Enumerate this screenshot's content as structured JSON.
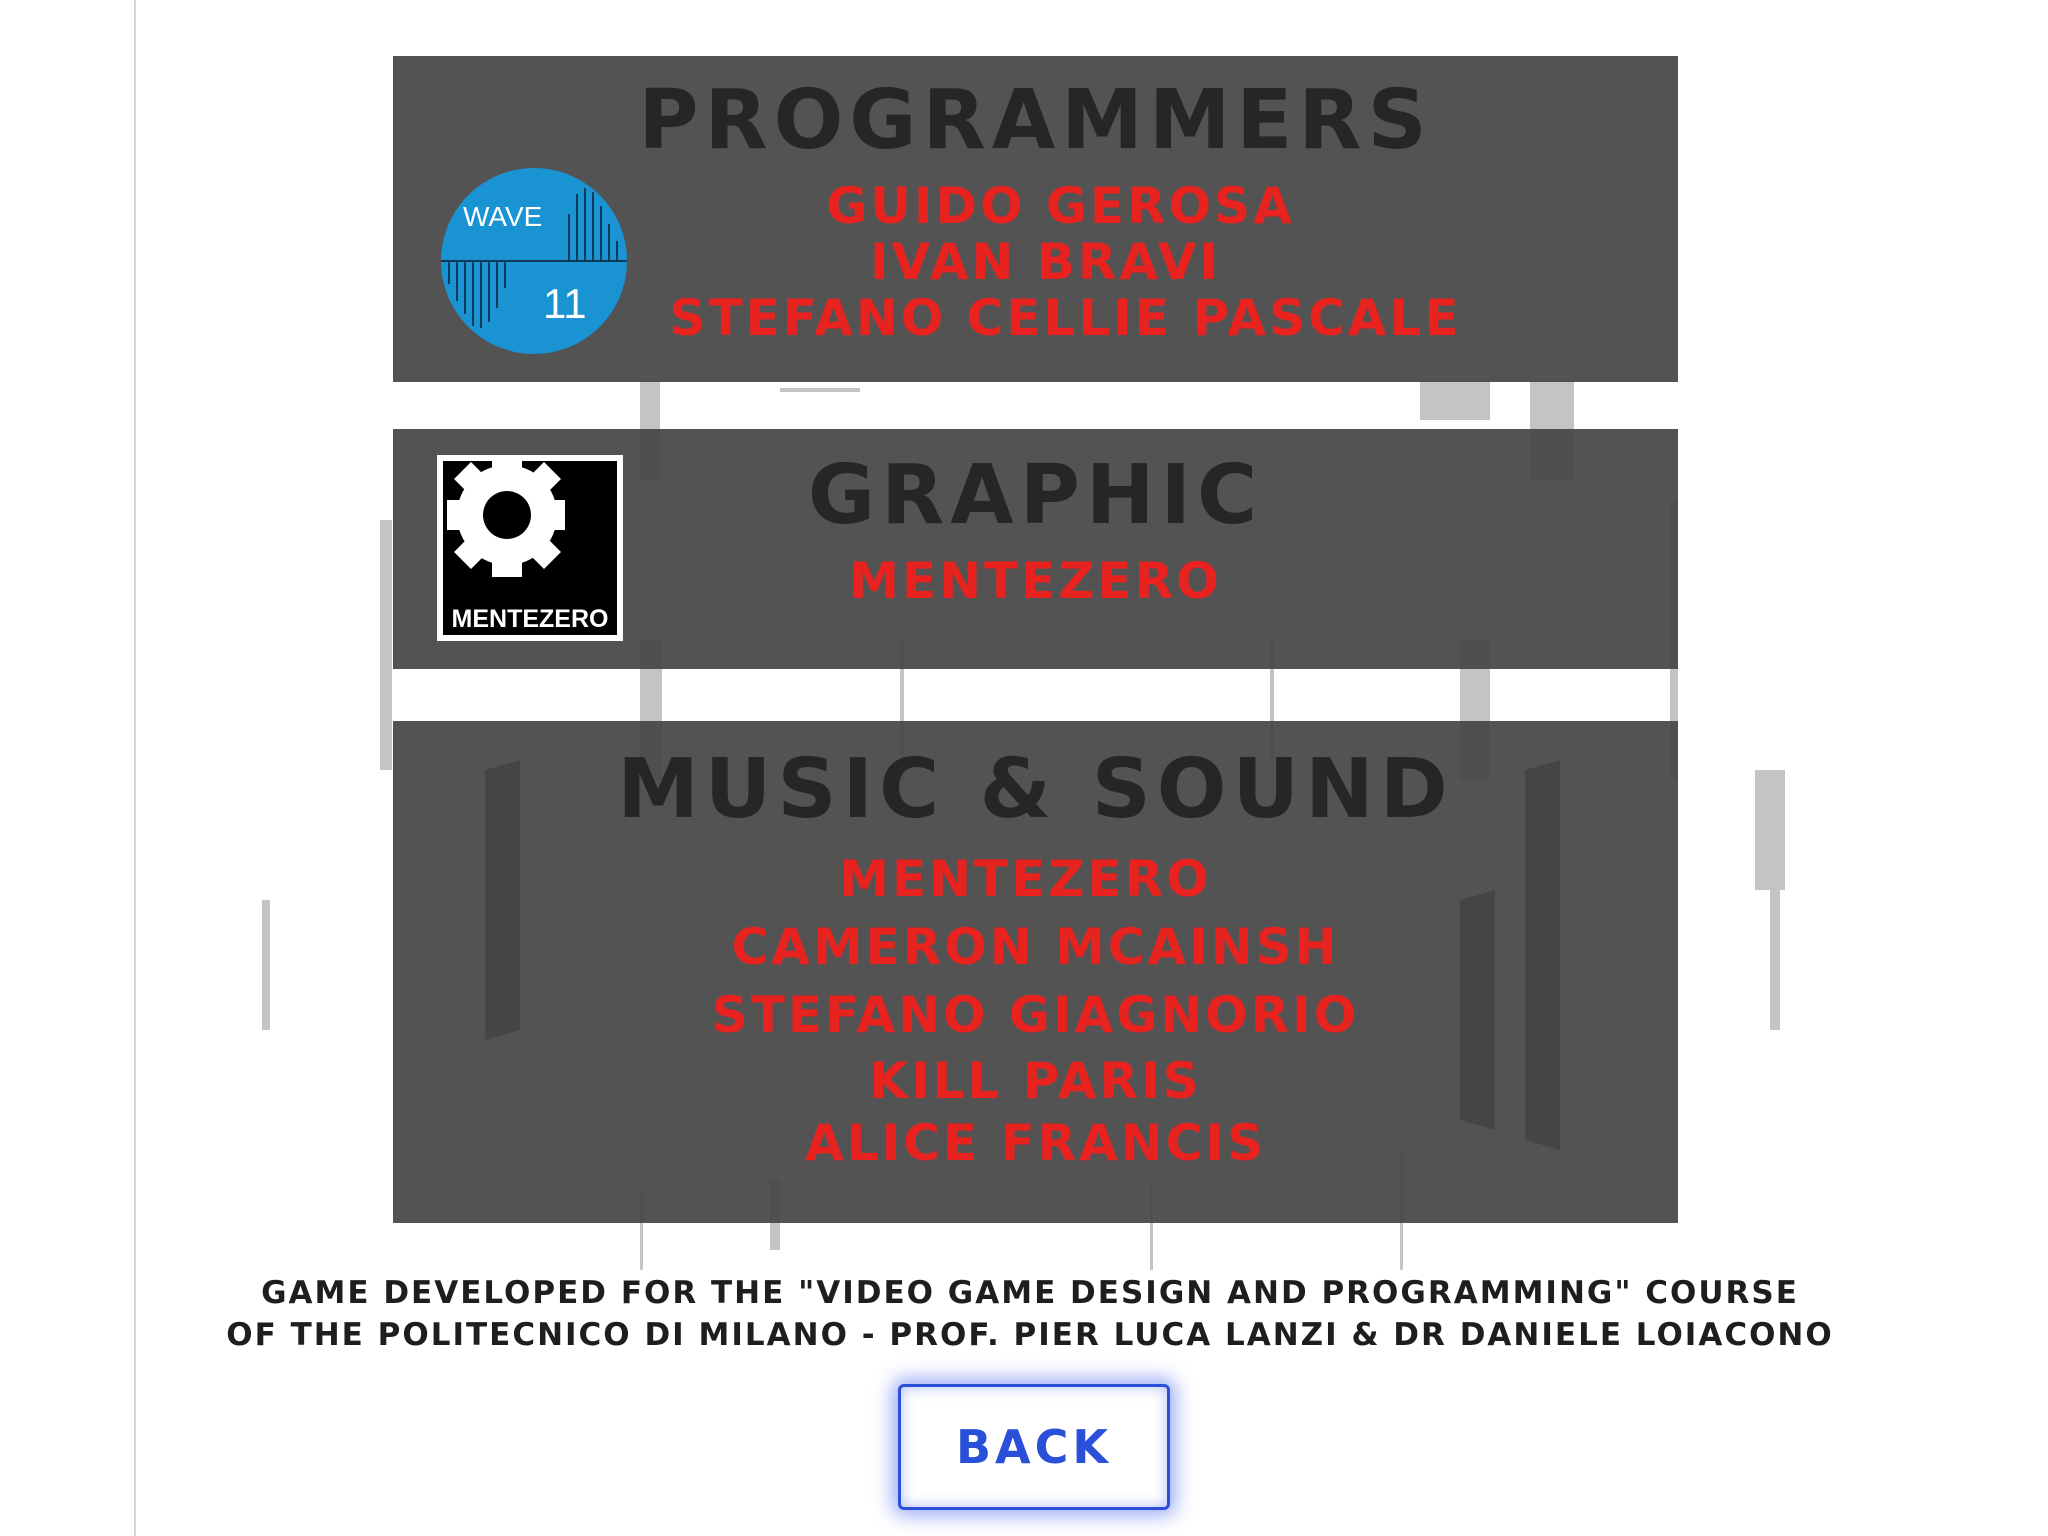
{
  "sections": {
    "programmers": {
      "title": "PROGRAMMERS",
      "names": [
        "GUIDO GEROSA",
        "IVAN BRAVI",
        "STEFANO CELLIE PASCALE"
      ],
      "logo": {
        "icon": "wave-11-logo",
        "text": "WAVE",
        "number": "11",
        "color": "#1a93d2"
      }
    },
    "graphic": {
      "title": "GRAPHIC",
      "names": [
        "MENTEZERO"
      ],
      "logo": {
        "icon": "mentezero-gear-logo",
        "text": "MENTEZERO"
      }
    },
    "music": {
      "title": "MUSIC & SOUND",
      "names": [
        "MENTEZERO",
        "CAMERON MCAINSH",
        "STEFANO GIAGNORIO",
        "KILL PARIS",
        "ALICE FRANCIS"
      ]
    }
  },
  "credits": {
    "line1": "GAME DEVELOPED FOR THE \"VIDEO GAME DESIGN AND PROGRAMMING\" COURSE",
    "line2": "OF THE POLITECNICO DI MILANO - PROF. PIER LUCA LANZI & DR DANIELE LOIACONO"
  },
  "back_button": {
    "label": "BACK"
  },
  "colors": {
    "panel": "#464646",
    "title": "#262626",
    "name": "#e8231f",
    "button": "#2a4fd8"
  }
}
